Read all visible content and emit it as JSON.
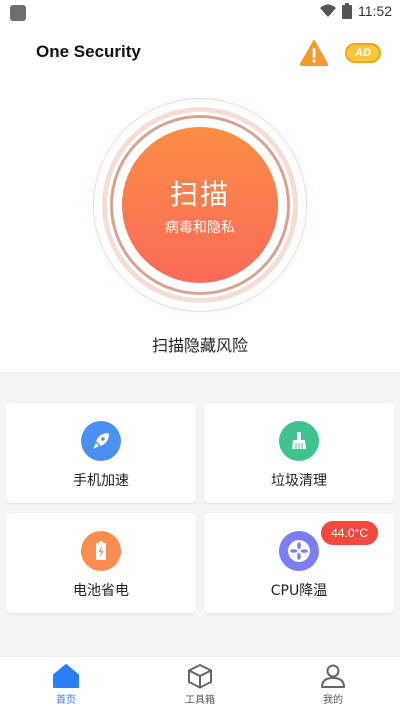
{
  "status_bar": {
    "time": "11:52"
  },
  "header": {
    "title": "One Security",
    "ad_label": "AD"
  },
  "scan": {
    "label": "扫描",
    "sub_label": "病毒和隐私",
    "hint": "扫描隐藏风险"
  },
  "features": [
    {
      "label": "手机加速",
      "icon": "rocket-icon",
      "color": "#4a90f0"
    },
    {
      "label": "垃圾清理",
      "icon": "broom-icon",
      "color": "#3fc48e"
    },
    {
      "label": "电池省电",
      "icon": "battery-icon",
      "color": "#fb8d4e"
    },
    {
      "label": "CPU降温",
      "icon": "fan-icon",
      "color": "#7b7df0",
      "badge": "44.0°C"
    }
  ],
  "nav": [
    {
      "label": "首页",
      "icon": "home-icon",
      "active": true
    },
    {
      "label": "工具箱",
      "icon": "box-icon",
      "active": false
    },
    {
      "label": "我的",
      "icon": "user-icon",
      "active": false
    }
  ],
  "colors": {
    "accent": "#2d7ff9",
    "scan_gradient_top": "#fb8d44",
    "scan_gradient_bottom": "#fb6b5a",
    "badge": "#f2493f"
  }
}
